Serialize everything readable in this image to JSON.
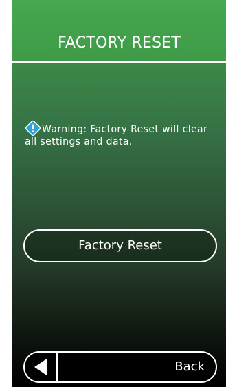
{
  "header": {
    "title": "FACTORY RESET"
  },
  "warning": {
    "icon": "info-icon",
    "text": "Warning: Factory Reset will clear all settings and data."
  },
  "actions": {
    "factory_reset_label": "Factory Reset"
  },
  "nav": {
    "back_icon": "back-arrow-icon",
    "back_label": "Back"
  },
  "colors": {
    "header_green": "#43a14d",
    "background_dark": "#000000",
    "text": "#ffffff",
    "icon_blue": "#2aa3d8"
  }
}
